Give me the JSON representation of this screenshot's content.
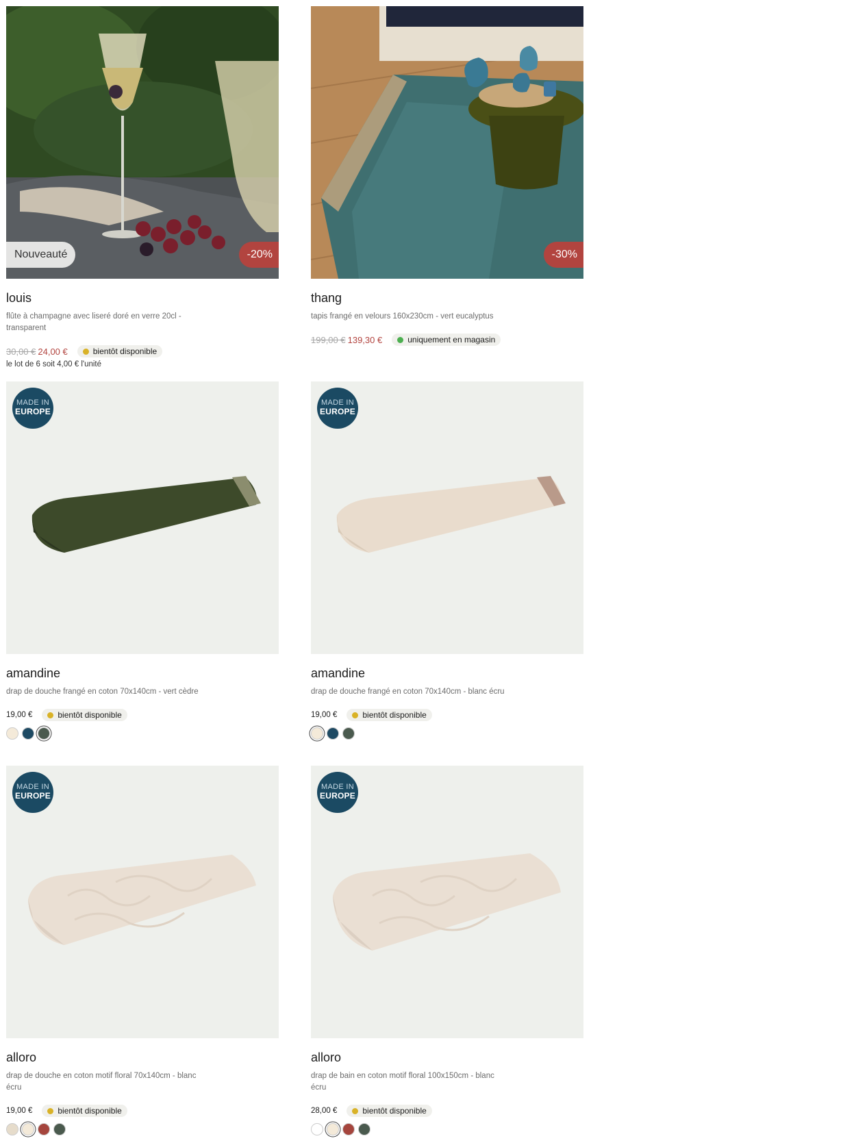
{
  "products": [
    {
      "name": "louis",
      "description": "flûte à champagne avec liseré doré en verre 20cl - transparent",
      "old_price": "30,00 €",
      "price": "24,00 €",
      "availability": "bientôt disponible",
      "availability_color": "#d9b227",
      "badge_new": "Nouveauté",
      "badge_discount": "-20%",
      "unit_note": "le lot de 6 soit 4,00 € l'unité"
    },
    {
      "name": "thang",
      "description": "tapis frangé en velours 160x230cm - vert eucalyptus",
      "old_price": "199,00 €",
      "price": "139,30 €",
      "availability": "uniquement en magasin",
      "availability_color": "#4caf50",
      "badge_discount": "-30%"
    },
    {
      "name": "amandine",
      "description": "drap de douche frangé en coton 70x140cm - vert cèdre",
      "price": "19,00 €",
      "availability": "bientôt disponible",
      "availability_color": "#d9b227",
      "made_in_top": "MADE IN",
      "made_in_bottom": "EUROPE",
      "swatches": [
        "#f4ead9",
        "#1e4a63",
        "#4a5a4e"
      ],
      "selected_swatch": 2
    },
    {
      "name": "amandine",
      "description": "drap de douche frangé en coton 70x140cm - blanc écru",
      "price": "19,00 €",
      "availability": "bientôt disponible",
      "availability_color": "#d9b227",
      "made_in_top": "MADE IN",
      "made_in_bottom": "EUROPE",
      "swatches": [
        "#f4ead9",
        "#1e4a63",
        "#4a5a4e"
      ],
      "selected_swatch": 0
    },
    {
      "name": "alloro",
      "description": "drap de douche en coton motif floral 70x140cm - blanc écru",
      "price": "19,00 €",
      "availability": "bientôt disponible",
      "availability_color": "#d9b227",
      "made_in_top": "MADE IN",
      "made_in_bottom": "EUROPE",
      "swatches": [
        "#e6dccb",
        "#f4ead9",
        "#a5453d",
        "#4a5a4e"
      ],
      "selected_swatch": 1
    },
    {
      "name": "alloro",
      "description": "drap de bain en coton motif floral 100x150cm - blanc écru",
      "price": "28,00 €",
      "availability": "bientôt disponible",
      "availability_color": "#d9b227",
      "made_in_top": "MADE IN",
      "made_in_bottom": "EUROPE",
      "swatches": [
        "#ffffff",
        "#f4ead9",
        "#a5453d",
        "#4a5a4e"
      ],
      "selected_swatch": 1
    }
  ]
}
